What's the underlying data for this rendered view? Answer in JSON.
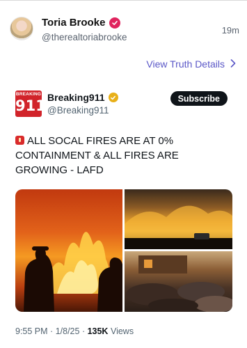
{
  "author": {
    "display_name": "Toria Brooke",
    "handle": "@therealtoriabrooke",
    "time": "19m"
  },
  "view_details_label": "View Truth Details",
  "quoted": {
    "logo_top": "BREAKING",
    "logo_number": "911",
    "name": "Breaking911",
    "handle": "@Breaking911",
    "subscribe_label": "Subscribe",
    "text": "ALL SOCAL FIRES ARE AT 0% CONTAINMENT & ALL FIRES ARE GROWING - LAFD",
    "footer": {
      "time": "9:55 PM",
      "date": "1/8/25",
      "views_count": "135K",
      "views_label": "Views"
    }
  },
  "colors": {
    "link": "#5a57c7",
    "verified_pink": "#e0245e",
    "verified_gold": "#e8b019",
    "logo_red": "#d1232a"
  },
  "icons": [
    "verified-badge-icon",
    "chevron-right-icon",
    "siren-emoji-icon"
  ]
}
